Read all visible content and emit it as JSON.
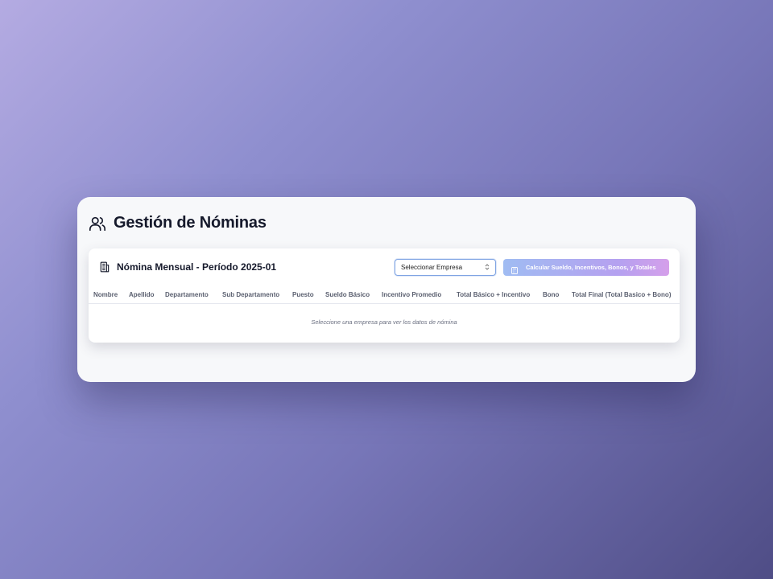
{
  "page": {
    "title": "Gestión de Nóminas",
    "icon": "users-icon"
  },
  "payroll": {
    "title": "Nómina Mensual - Período 2025-01",
    "icon": "building-document-icon",
    "company_select": {
      "value": "Seleccionar Empresa",
      "icon": "chevron-up-down-icon"
    },
    "calculate_button": {
      "label": "Calcular Sueldo, Incentivos, Bonos, y Totales",
      "icon": "calculator-icon",
      "enabled": false
    },
    "columns": [
      "Nombre",
      "Apellido",
      "Departamento",
      "Sub Departamento",
      "Puesto",
      "Sueldo Básico",
      "Incentivo Promedio",
      "Total Básico + Incentivo",
      "Bono",
      "Total Final (Total Basico + Bono)"
    ],
    "empty_message": "Seleccione una empresa para ver los datos de nómina"
  },
  "colors": {
    "accent_border": "#7fa4e3",
    "button_gradient_start": "#9bb9f2",
    "button_gradient_end": "#d39ae9",
    "title": "#15192b"
  }
}
